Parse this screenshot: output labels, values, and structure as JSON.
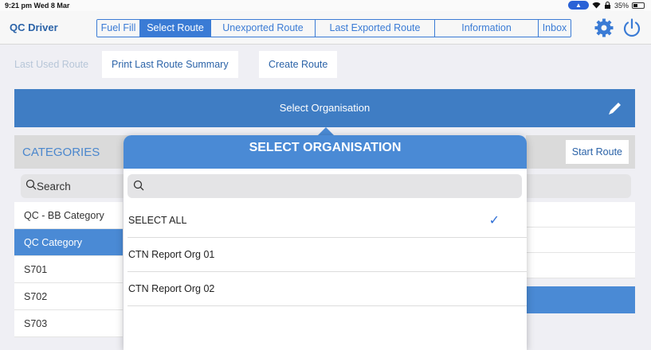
{
  "status_bar": {
    "time_date": "9:21 pm  Wed 8 Mar",
    "battery": "35%",
    "pill_glyph": "▲"
  },
  "header": {
    "app_title": "QC Driver",
    "tabs": [
      {
        "label": "Fuel Fill",
        "active": false
      },
      {
        "label": "Select Route",
        "active": true
      },
      {
        "label": "Unexported Route",
        "active": false
      },
      {
        "label": "Last Exported Route",
        "active": false
      },
      {
        "label": "Information",
        "active": false
      },
      {
        "label": "Inbox",
        "active": false
      }
    ],
    "icons": [
      "gear-icon",
      "power-icon"
    ],
    "accent": "#3a7bd5"
  },
  "toolbar": {
    "last_used_route": "Last Used Route",
    "print_summary": "Print Last Route Summary",
    "create_route": "Create Route"
  },
  "banner": {
    "title": "Select Organisation",
    "icon": "pencil-icon",
    "color": "#3f7dc4"
  },
  "categories": {
    "header": "CATEGORIES",
    "search_placeholder": "Search",
    "items": [
      {
        "label": "QC - BB Category",
        "selected": false
      },
      {
        "label": "QC Category",
        "selected": true
      },
      {
        "label": "S701",
        "selected": false
      },
      {
        "label": "S702",
        "selected": false
      },
      {
        "label": "S703",
        "selected": false
      }
    ]
  },
  "right_panel": {
    "start_route": "Start Route"
  },
  "popover": {
    "title": "SELECT ORGANISATION",
    "search_value": "",
    "items": [
      {
        "label": "SELECT ALL",
        "checked": true
      },
      {
        "label": "CTN Report Org 01",
        "checked": false
      },
      {
        "label": "CTN Report Org 02",
        "checked": false
      }
    ],
    "check_glyph": "✓",
    "header_color": "#4a8ad5"
  }
}
